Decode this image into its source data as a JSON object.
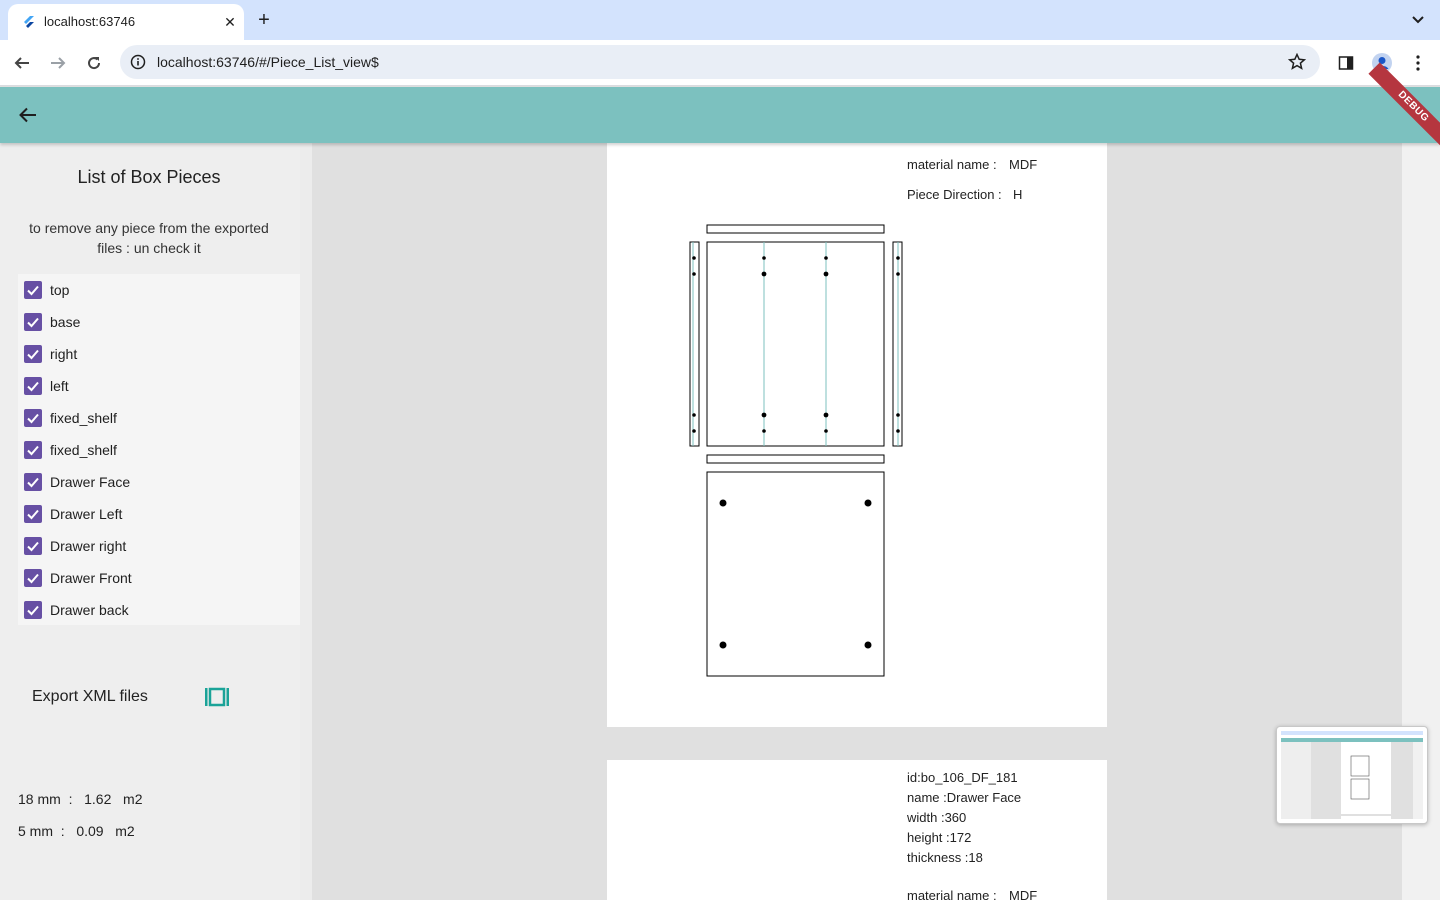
{
  "browser": {
    "tab_title": "localhost:63746",
    "url": "localhost:63746/#/Piece_List_view$"
  },
  "sidebar": {
    "title": "List of Box Pieces",
    "hint": "to remove any piece from the exported files : un check it",
    "pieces": [
      {
        "label": "top",
        "checked": true
      },
      {
        "label": "base",
        "checked": true
      },
      {
        "label": "right",
        "checked": true
      },
      {
        "label": "left",
        "checked": true
      },
      {
        "label": "fixed_shelf",
        "checked": true
      },
      {
        "label": "fixed_shelf",
        "checked": true
      },
      {
        "label": "Drawer Face",
        "checked": true
      },
      {
        "label": "Drawer Left",
        "checked": true
      },
      {
        "label": "Drawer right",
        "checked": true
      },
      {
        "label": "Drawer Front",
        "checked": true
      },
      {
        "label": "Drawer back",
        "checked": true
      }
    ],
    "export_label": "Export XML files",
    "stats": [
      "18 mm  :   1.62   m2",
      "5 mm  :   0.09   m2"
    ]
  },
  "card1": {
    "material_label": "material name :",
    "material_value": "MDF",
    "direction_label": "Piece Direction :",
    "direction_value": "H"
  },
  "card2": {
    "id": "id:bo_106_DF_181",
    "name": "name :Drawer Face",
    "width": "width :360",
    "height": "height :172",
    "thickness": "thickness :18",
    "material_label": "material name :",
    "material_value": "MDF"
  },
  "colors": {
    "appbar": "#7cc1bf",
    "checkbox": "#6750a4",
    "debug_banner": "#b5363f",
    "export_icon": "#1aa398",
    "groove_line": "#7cc1bf"
  },
  "debug_label": "DEBUG"
}
